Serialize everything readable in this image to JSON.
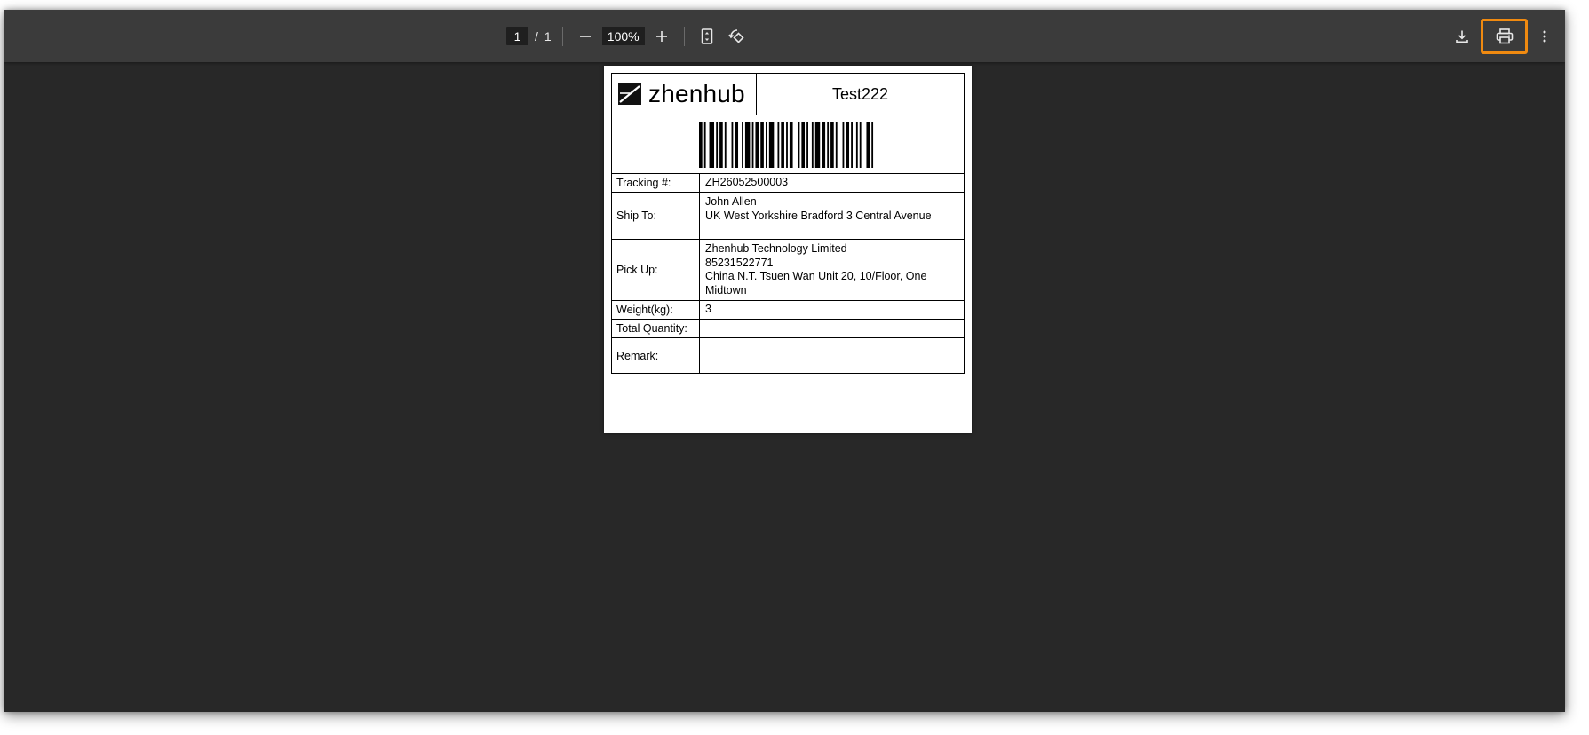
{
  "toolbar": {
    "page_current": "1",
    "page_separator": "/",
    "page_total": "1",
    "zoom_value": "100%",
    "icons": [
      "minus-icon",
      "plus-icon",
      "fit-page-icon",
      "rotate-icon",
      "download-icon",
      "print-icon",
      "more-vert-icon"
    ],
    "highlight_color": "#f08a10"
  },
  "label": {
    "brand": "zhenhub",
    "title": "Test222",
    "rows": {
      "tracking": {
        "key": "Tracking #:",
        "value": "ZH26052500003"
      },
      "ship_to": {
        "key": "Ship To:",
        "line1": "John Allen",
        "line2": "UK West Yorkshire Bradford 3 Central Avenue"
      },
      "pick_up": {
        "key": "Pick Up:",
        "line1": "Zhenhub Technology Limited",
        "line2": "85231522771",
        "line3": "China N.T. Tsuen Wan Unit 20, 10/Floor, One Midtown"
      },
      "weight": {
        "key": "Weight(kg):",
        "value": "3"
      },
      "total_quantity": {
        "key": "Total Quantity:",
        "value": ""
      },
      "remark": {
        "key": "Remark:",
        "value": ""
      }
    }
  }
}
